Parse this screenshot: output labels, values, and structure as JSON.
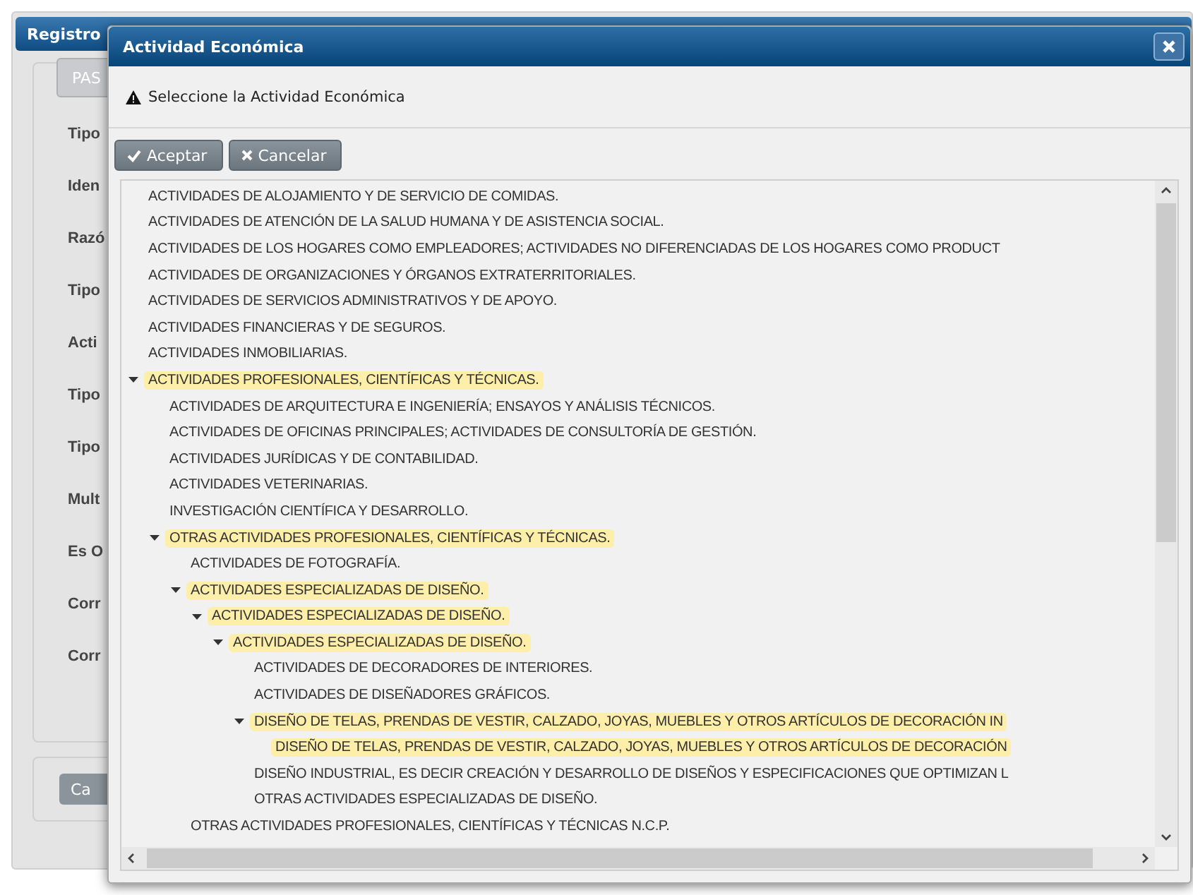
{
  "background": {
    "header": "Registro",
    "tab": "PAS",
    "labels": [
      "Tipo",
      "Iden",
      "Razó",
      "Tipo",
      "Acti",
      "Tipo",
      "Tipo",
      "Mult",
      "Es O",
      "Corr",
      "Corr"
    ],
    "cancel_button": "Ca"
  },
  "dialog": {
    "title": "Actividad Económica",
    "message": "Seleccione la Actividad Económica",
    "buttons": [
      {
        "label": "Aceptar",
        "kind": "accept"
      },
      {
        "label": "Cancelar",
        "kind": "cancel"
      }
    ],
    "tree": [
      {
        "label": "ACTIVIDADES DE ALOJAMIENTO Y DE SERVICIO DE COMIDAS.",
        "highlighted": false
      },
      {
        "label": "ACTIVIDADES DE ATENCIÓN DE LA SALUD HUMANA Y DE ASISTENCIA SOCIAL.",
        "highlighted": false
      },
      {
        "label": "ACTIVIDADES DE LOS HOGARES COMO EMPLEADORES; ACTIVIDADES NO DIFERENCIADAS DE LOS HOGARES COMO PRODUCT",
        "highlighted": false
      },
      {
        "label": "ACTIVIDADES DE ORGANIZACIONES Y ÓRGANOS EXTRATERRITORIALES.",
        "highlighted": false
      },
      {
        "label": "ACTIVIDADES DE SERVICIOS ADMINISTRATIVOS Y DE APOYO.",
        "highlighted": false
      },
      {
        "label": "ACTIVIDADES FINANCIERAS Y DE SEGUROS.",
        "highlighted": false
      },
      {
        "label": "ACTIVIDADES INMOBILIARIAS.",
        "highlighted": false
      },
      {
        "label": "ACTIVIDADES PROFESIONALES, CIENTÍFICAS Y TÉCNICAS.",
        "highlighted": true,
        "expanded": true,
        "children": [
          {
            "label": "ACTIVIDADES DE ARQUITECTURA E INGENIERÍA; ENSAYOS Y ANÁLISIS TÉCNICOS.",
            "highlighted": false
          },
          {
            "label": "ACTIVIDADES DE OFICINAS PRINCIPALES; ACTIVIDADES DE CONSULTORÍA DE GESTIÓN.",
            "highlighted": false
          },
          {
            "label": "ACTIVIDADES JURÍDICAS Y DE CONTABILIDAD.",
            "highlighted": false
          },
          {
            "label": "ACTIVIDADES VETERINARIAS.",
            "highlighted": false
          },
          {
            "label": "INVESTIGACIÓN CIENTÍFICA Y DESARROLLO.",
            "highlighted": false
          },
          {
            "label": "OTRAS ACTIVIDADES PROFESIONALES, CIENTÍFICAS Y TÉCNICAS.",
            "highlighted": true,
            "expanded": true,
            "children": [
              {
                "label": "ACTIVIDADES DE FOTOGRAFÍA.",
                "highlighted": false
              },
              {
                "label": "ACTIVIDADES ESPECIALIZADAS DE DISEÑO.",
                "highlighted": true,
                "expanded": true,
                "children": [
                  {
                    "label": "ACTIVIDADES ESPECIALIZADAS DE DISEÑO.",
                    "highlighted": true,
                    "expanded": true,
                    "children": [
                      {
                        "label": "ACTIVIDADES ESPECIALIZADAS DE DISEÑO.",
                        "highlighted": true,
                        "expanded": true,
                        "children": [
                          {
                            "label": "ACTIVIDADES DE DECORADORES DE INTERIORES.",
                            "highlighted": false
                          },
                          {
                            "label": "ACTIVIDADES DE DISEÑADORES GRÁFICOS.",
                            "highlighted": false
                          },
                          {
                            "label": "DISEÑO DE TELAS, PRENDAS DE VESTIR, CALZADO, JOYAS, MUEBLES Y OTROS ARTÍCULOS DE DECORACIÓN IN",
                            "highlighted": true,
                            "expanded": true,
                            "children": [
                              {
                                "label": "DISEÑO DE TELAS, PRENDAS DE VESTIR, CALZADO, JOYAS, MUEBLES Y OTROS ARTÍCULOS DE DECORACIÓN",
                                "highlighted": true
                              }
                            ]
                          },
                          {
                            "label": "DISEÑO INDUSTRIAL, ES DECIR CREACIÓN Y DESARROLLO DE DISEÑOS Y ESPECIFICACIONES QUE OPTIMIZAN L",
                            "highlighted": false
                          },
                          {
                            "label": "OTRAS ACTIVIDADES ESPECIALIZADAS DE DISEÑO.",
                            "highlighted": false
                          }
                        ]
                      }
                    ]
                  }
                ]
              },
              {
                "label": "OTRAS ACTIVIDADES PROFESIONALES, CIENTÍFICAS Y TÉCNICAS N.C.P.",
                "highlighted": false
              }
            ]
          }
        ]
      }
    ]
  }
}
